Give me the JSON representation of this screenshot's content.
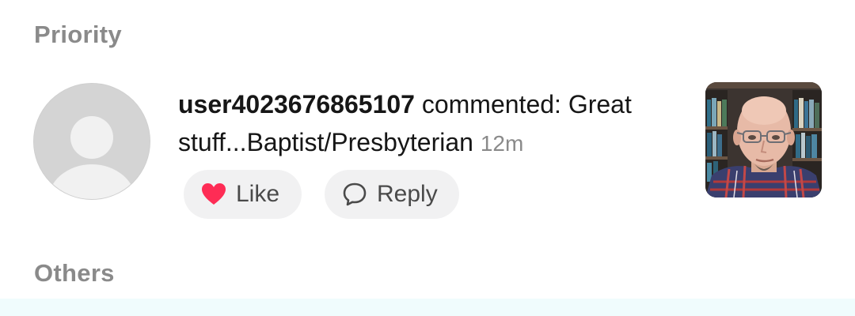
{
  "sections": {
    "priority": "Priority",
    "others": "Others"
  },
  "notification": {
    "username": "user4023676865107",
    "action": " commented: Great stuff...Baptist/Presbyterian",
    "time": "12m",
    "avatar_icon": "default-user-avatar",
    "thumbnail_icon": "video-thumbnail-man-bookshelf"
  },
  "actions": {
    "like_label": "Like",
    "like_icon": "heart-icon",
    "reply_label": "Reply",
    "reply_icon": "speech-bubble-icon"
  },
  "colors": {
    "heart": "#fe2c55",
    "section_header": "#8a8a8a",
    "pill_bg": "#f1f1f2",
    "next_row_bg": "#f0fcfd"
  }
}
